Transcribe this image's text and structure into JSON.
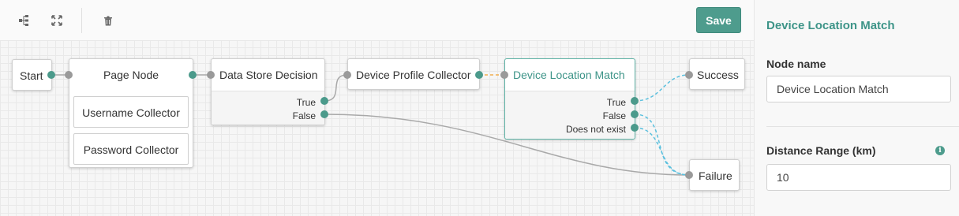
{
  "toolbar": {
    "icons": [
      "tree-layout-icon",
      "fit-screen-icon",
      "trash-icon"
    ],
    "save_label": "Save"
  },
  "nodes": {
    "start": {
      "label": "Start"
    },
    "page_node": {
      "label": "Page Node",
      "children": [
        "Username Collector",
        "Password Collector"
      ]
    },
    "data_store_decision": {
      "label": "Data Store Decision",
      "outcomes": [
        "True",
        "False"
      ]
    },
    "device_profile_collector": {
      "label": "Device Profile Collector"
    },
    "device_location_match": {
      "label": "Device Location Match",
      "outcomes": [
        "True",
        "False",
        "Does not exist"
      ]
    },
    "success": {
      "label": "Success"
    },
    "failure": {
      "label": "Failure"
    }
  },
  "panel": {
    "title": "Device Location Match",
    "node_name_label": "Node name",
    "node_name_value": "Device Location Match",
    "distance_label": "Distance Range (km)",
    "distance_value": "10",
    "info_icon": "info-icon"
  },
  "colors": {
    "accent": "#4e9c8d",
    "selected_text": "#3d9488",
    "selected_wire": "#5bc0de",
    "pending_wire": "#f0ad4e",
    "default_wire": "#a9a9a9"
  }
}
